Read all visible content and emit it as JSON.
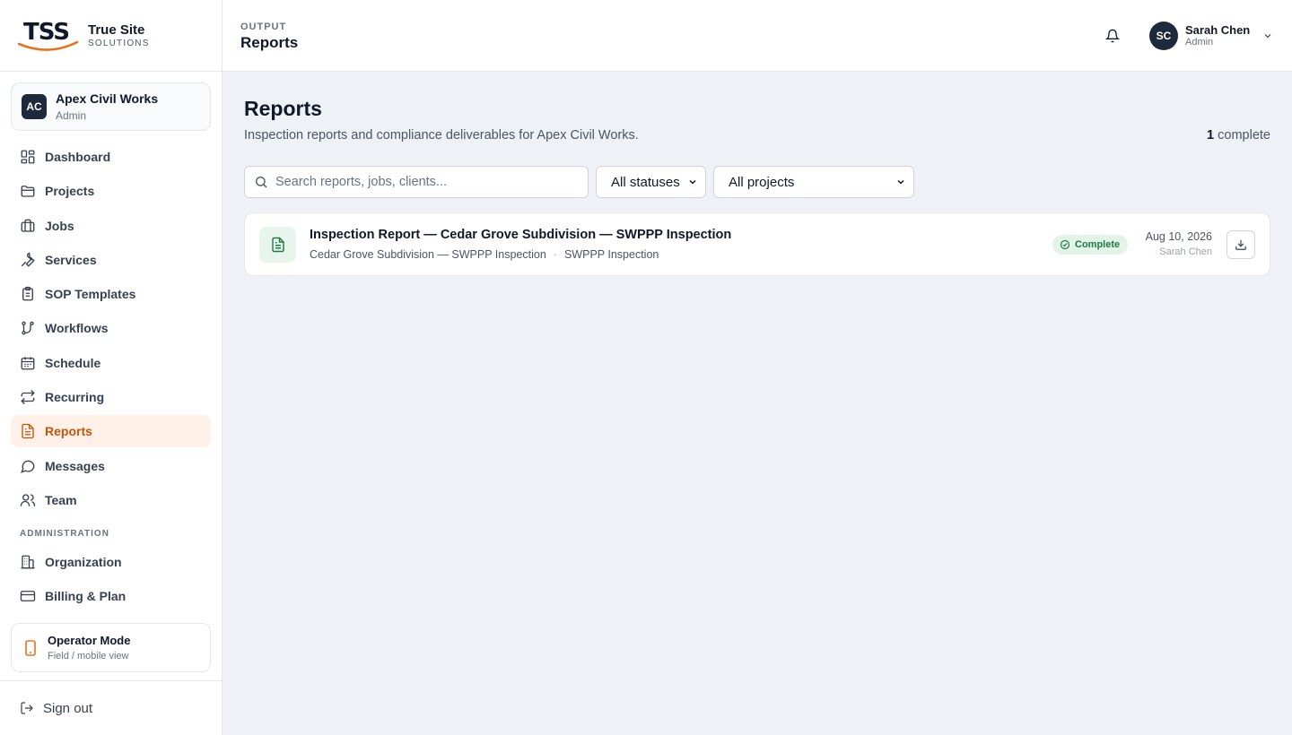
{
  "brand": {
    "logo_text": "TSS",
    "name": "True Site",
    "tagline": "SOLUTIONS",
    "accent": "#e8731e"
  },
  "org": {
    "initials": "AC",
    "name": "Apex Civil Works",
    "role": "Admin"
  },
  "sidebar": {
    "items": [
      {
        "label": "Dashboard",
        "icon": "grid-icon"
      },
      {
        "label": "Projects",
        "icon": "folder-icon"
      },
      {
        "label": "Jobs",
        "icon": "briefcase-icon"
      },
      {
        "label": "Services",
        "icon": "wrench-icon"
      },
      {
        "label": "SOP Templates",
        "icon": "clipboard-icon"
      },
      {
        "label": "Workflows",
        "icon": "workflow-icon"
      },
      {
        "label": "Schedule",
        "icon": "calendar-icon"
      },
      {
        "label": "Recurring",
        "icon": "repeat-icon"
      },
      {
        "label": "Reports",
        "icon": "file-text-icon",
        "active": true
      },
      {
        "label": "Messages",
        "icon": "message-circle-icon"
      },
      {
        "label": "Team",
        "icon": "users-icon"
      }
    ],
    "admin_section_label": "ADMINISTRATION",
    "admin_items": [
      {
        "label": "Organization",
        "icon": "building-icon"
      },
      {
        "label": "Billing & Plan",
        "icon": "credit-card-icon"
      }
    ],
    "operator": {
      "title": "Operator Mode",
      "subtitle": "Field / mobile view",
      "icon": "smartphone-icon"
    },
    "signout_label": "Sign out"
  },
  "header": {
    "eyebrow": "OUTPUT",
    "title": "Reports",
    "user": {
      "initials": "SC",
      "name": "Sarah Chen",
      "role": "Admin"
    }
  },
  "main": {
    "title": "Reports",
    "subtitle": "Inspection reports and compliance deliverables for Apex Civil Works.",
    "count_value": "1",
    "count_label": "complete",
    "search_placeholder": "Search reports, jobs, clients...",
    "status_filter": "All statuses",
    "project_filter": "All projects",
    "reports": [
      {
        "title": "Inspection Report — Cedar Grove Subdivision — SWPPP Inspection",
        "job": "Cedar Grove Subdivision — SWPPP Inspection",
        "service": "SWPPP Inspection",
        "status": "Complete",
        "date": "Aug 10, 2026",
        "author": "Sarah Chen"
      }
    ]
  },
  "colors": {
    "active_bg": "#fff1e8",
    "active_fg": "#c2570c",
    "status_bg": "#e3f3e8",
    "status_fg": "#1e7a45"
  }
}
